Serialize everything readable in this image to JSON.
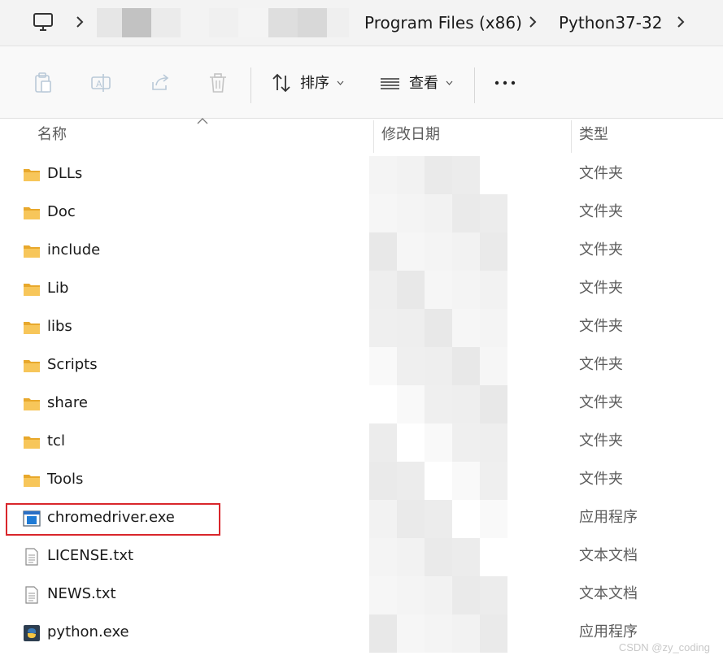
{
  "address": {
    "crumbs": [
      "Program Files (x86)",
      "Python37-32"
    ]
  },
  "toolbar": {
    "sort_label": "排序",
    "view_label": "查看"
  },
  "columns": {
    "name": "名称",
    "modified": "修改日期",
    "type": "类型"
  },
  "files": [
    {
      "name": "DLLs",
      "type": "文件夹",
      "icon": "folder-icon"
    },
    {
      "name": "Doc",
      "type": "文件夹",
      "icon": "folder-icon"
    },
    {
      "name": "include",
      "type": "文件夹",
      "icon": "folder-icon"
    },
    {
      "name": "Lib",
      "type": "文件夹",
      "icon": "folder-icon"
    },
    {
      "name": "libs",
      "type": "文件夹",
      "icon": "folder-icon"
    },
    {
      "name": "Scripts",
      "type": "文件夹",
      "icon": "folder-icon"
    },
    {
      "name": "share",
      "type": "文件夹",
      "icon": "folder-icon"
    },
    {
      "name": "tcl",
      "type": "文件夹",
      "icon": "folder-icon"
    },
    {
      "name": "Tools",
      "type": "文件夹",
      "icon": "folder-icon"
    },
    {
      "name": "chromedriver.exe",
      "type": "应用程序",
      "icon": "application-icon"
    },
    {
      "name": "LICENSE.txt",
      "type": "文本文档",
      "icon": "text-document-icon"
    },
    {
      "name": "NEWS.txt",
      "type": "文本文档",
      "icon": "text-document-icon"
    },
    {
      "name": "python.exe",
      "type": "应用程序",
      "icon": "python-icon"
    }
  ],
  "watermark": "CSDN @zy_coding",
  "colors": {
    "folder": "#f5c04a",
    "highlight": "#d9262b",
    "address_bg": "#f3f3f3"
  }
}
